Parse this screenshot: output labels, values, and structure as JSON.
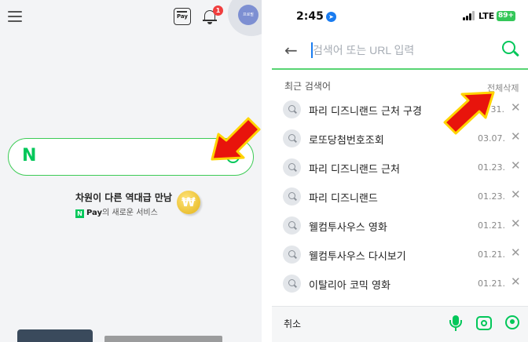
{
  "left_panel": {
    "header": {
      "menu_icon": "hamburger-menu-icon",
      "pay_icon_label": "Pay",
      "notification_count": "1",
      "avatar_text": "프로필"
    },
    "search": {
      "logo_letter": "N",
      "placeholder": ""
    },
    "promo": {
      "headline": "차원이 다른 역대급 만남",
      "sub_brand_mark": "N",
      "sub_brand": "Pay",
      "sub_text": "의 새로운 서비스",
      "coin_symbol": "₩"
    }
  },
  "right_panel": {
    "status_bar": {
      "time": "2:45",
      "network": "LTE",
      "battery": "89+"
    },
    "url_bar": {
      "back_icon": "back-arrow-icon",
      "placeholder": "검색어 또는 URL 입력",
      "search_icon": "search-icon"
    },
    "recent": {
      "title": "최근 검색어",
      "delete_all": "전체삭제",
      "items": [
        {
          "label": "파리 디즈니랜드 근처 구경",
          "date": "31."
        },
        {
          "label": "로또당첨번호조회",
          "date": "03.07."
        },
        {
          "label": "파리 디즈니랜드 근처",
          "date": "01.23."
        },
        {
          "label": "파리 디즈니랜드",
          "date": "01.23."
        },
        {
          "label": "웰컴투사우스 영화",
          "date": "01.21."
        },
        {
          "label": "웰컴투사우스 다시보기",
          "date": "01.21."
        },
        {
          "label": "이탈리아 코믹 영화",
          "date": "01.21."
        }
      ],
      "remove_symbol": "✕"
    },
    "bottom_bar": {
      "cancel": "취소",
      "icons": [
        "microphone-icon",
        "lens-camera-icon",
        "location-pin-icon"
      ]
    }
  },
  "colors": {
    "brand_green": "#03c75a",
    "annotation_red": "#e8140c",
    "annotation_yellow": "#ffd400"
  }
}
